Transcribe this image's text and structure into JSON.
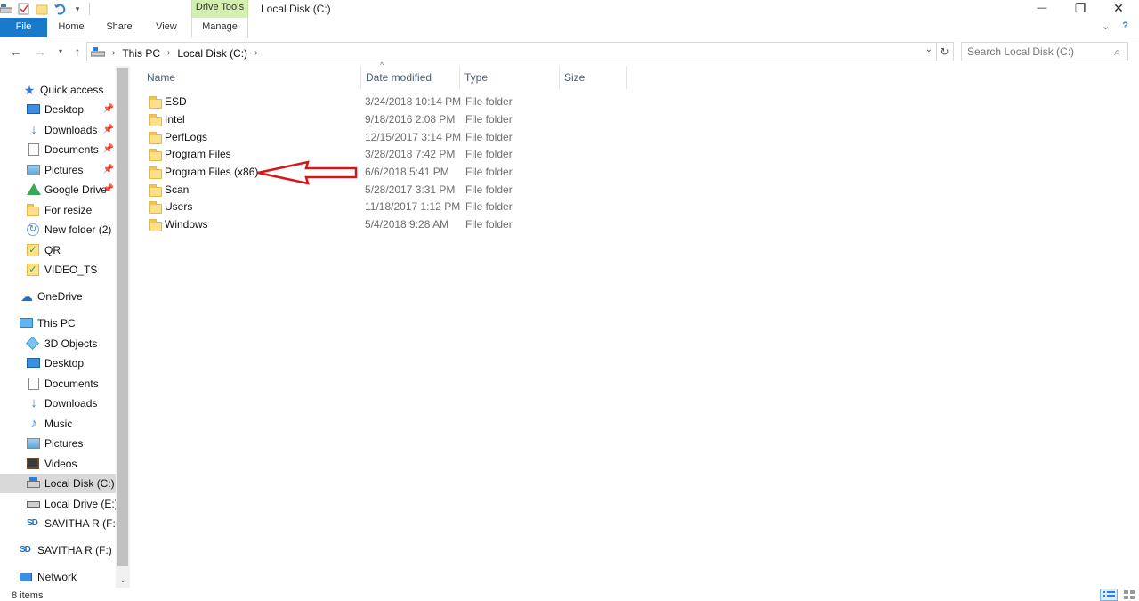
{
  "window": {
    "title": "Local Disk (C:)",
    "contextual_tab_group": "Drive Tools",
    "minimize": "—",
    "maximize": "❐",
    "close": "✕"
  },
  "ribbon": {
    "tabs": [
      {
        "label": "File"
      },
      {
        "label": "Home"
      },
      {
        "label": "Share"
      },
      {
        "label": "View"
      },
      {
        "label": "Manage"
      }
    ],
    "collapse_icon": "chevron-down-icon",
    "help_icon": "help-icon"
  },
  "address": {
    "breadcrumbs": [
      "This PC",
      "Local Disk (C:)"
    ],
    "search_placeholder": "Search Local Disk (C:)"
  },
  "nav": {
    "quick_access": {
      "label": "Quick access",
      "items": [
        {
          "label": "Desktop",
          "icon": "desktop-icon",
          "pinned": true
        },
        {
          "label": "Downloads",
          "icon": "downloads-icon",
          "pinned": true
        },
        {
          "label": "Documents",
          "icon": "documents-icon",
          "pinned": true
        },
        {
          "label": "Pictures",
          "icon": "pictures-icon",
          "pinned": true
        },
        {
          "label": "Google Drive",
          "icon": "google-drive-icon",
          "pinned": true
        },
        {
          "label": "For resize",
          "icon": "folder-icon",
          "pinned": false
        },
        {
          "label": "New folder (2)",
          "icon": "sync-folder-icon",
          "pinned": false
        },
        {
          "label": "QR",
          "icon": "synced-folder-icon",
          "pinned": false
        },
        {
          "label": "VIDEO_TS",
          "icon": "synced-folder-icon",
          "pinned": false
        }
      ]
    },
    "onedrive": {
      "label": "OneDrive"
    },
    "this_pc": {
      "label": "This PC",
      "items": [
        {
          "label": "3D Objects",
          "icon": "3d-objects-icon"
        },
        {
          "label": "Desktop",
          "icon": "desktop-icon"
        },
        {
          "label": "Documents",
          "icon": "documents-icon"
        },
        {
          "label": "Downloads",
          "icon": "downloads-icon"
        },
        {
          "label": "Music",
          "icon": "music-icon"
        },
        {
          "label": "Pictures",
          "icon": "pictures-icon"
        },
        {
          "label": "Videos",
          "icon": "videos-icon"
        },
        {
          "label": "Local Disk (C:)",
          "icon": "local-disk-icon",
          "selected": true
        },
        {
          "label": "Local Drive (E:)",
          "icon": "hard-drive-icon"
        },
        {
          "label": "SAVITHA R (F:)",
          "icon": "sd-card-icon"
        }
      ]
    },
    "removable": {
      "label": "SAVITHA R (F:)"
    },
    "network": {
      "label": "Network"
    }
  },
  "columns": {
    "name": "Name",
    "date": "Date modified",
    "type": "Type",
    "size": "Size"
  },
  "files": [
    {
      "name": "ESD",
      "date": "3/24/2018 10:14 PM",
      "type": "File folder"
    },
    {
      "name": "Intel",
      "date": "9/18/2016 2:08 PM",
      "type": "File folder"
    },
    {
      "name": "PerfLogs",
      "date": "12/15/2017 3:14 PM",
      "type": "File folder"
    },
    {
      "name": "Program Files",
      "date": "3/28/2018 7:42 PM",
      "type": "File folder"
    },
    {
      "name": "Program Files (x86)",
      "date": "6/6/2018 5:41 PM",
      "type": "File folder"
    },
    {
      "name": "Scan",
      "date": "5/28/2017 3:31 PM",
      "type": "File folder"
    },
    {
      "name": "Users",
      "date": "11/18/2017 1:12 PM",
      "type": "File folder"
    },
    {
      "name": "Windows",
      "date": "5/4/2018 9:28 AM",
      "type": "File folder"
    }
  ],
  "status": {
    "item_count": "8 items"
  },
  "colors": {
    "file_tab": "#1979ca",
    "drive_tools": "#d3f0b0",
    "annotation_arrow": "#d8141a",
    "selected_nav": "#d9d9d9"
  }
}
